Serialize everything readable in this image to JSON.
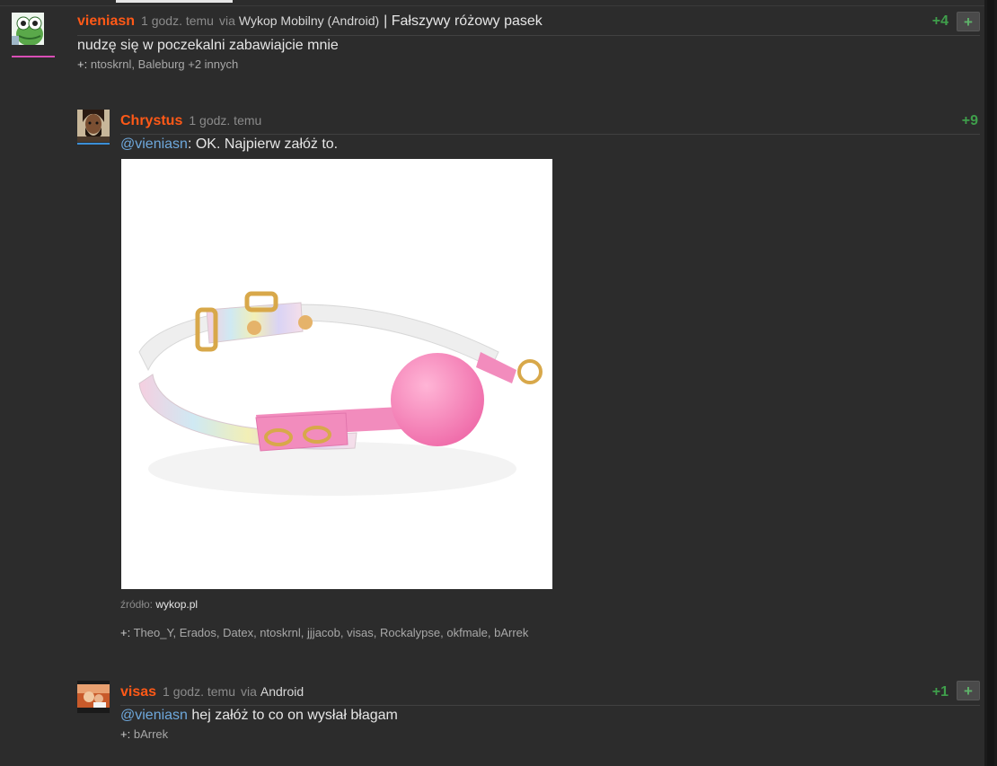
{
  "entry": {
    "author": "vieniasn",
    "time": "1 godz. temu",
    "via_label": "via",
    "via_app": "Wykop Mobilny (Android)",
    "extra": "| Fałszywy różowy pasek",
    "score": "+4",
    "plus_label": "+",
    "body": "nudzę się w poczekalni zabawiajcie mnie",
    "voters_label": "+:",
    "voters": "ntoskrnl, Baleburg +2 innych"
  },
  "comments": [
    {
      "author": "Chrystus",
      "time": "1 godz. temu",
      "score": "+9",
      "mention": "@vieniasn",
      "body": ": OK. Najpierw załóż to.",
      "source_label": "źródło:",
      "source_link": "wykop.pl",
      "voters_label": "+:",
      "voters": "Theo_Y, Erados, Datex, ntoskrnl, jjjacob, visas, Rockalypse, okfmale, bArrek"
    },
    {
      "author": "visas",
      "time": "1 godz. temu",
      "via_label": "via",
      "via_app": "Android",
      "score": "+1",
      "plus_label": "+",
      "mention": "@vieniasn",
      "body": " hej załóż to co on wysłał błagam",
      "voters_label": "+:",
      "voters": "bArrek"
    }
  ],
  "colors": {
    "background": "#2c2c2c",
    "nick": "#ff5917",
    "score": "#3f9f4b",
    "mention": "#6ea8dc"
  },
  "icons": {
    "plus": "plus-icon",
    "avatar1": "frog-avatar",
    "avatar2": "bearded-man-avatar",
    "avatar3": "photo-avatar"
  }
}
